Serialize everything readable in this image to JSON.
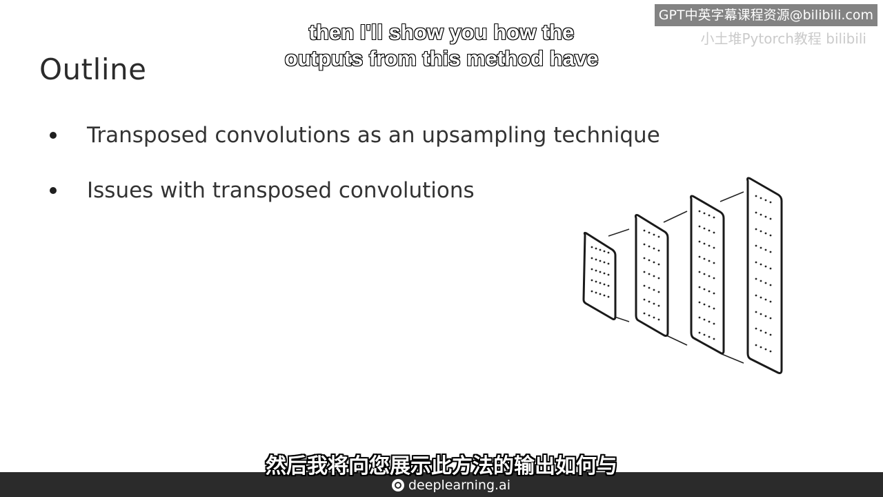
{
  "slide": {
    "title": "Outline",
    "bullets": [
      "Transposed convolutions as an upsampling technique",
      "Issues with transposed convolutions"
    ]
  },
  "subtitles": {
    "english_line1": "then I'll show you how the",
    "english_line2": "outputs from this method have",
    "chinese": "然后我将向您展示此方法的输出如何与"
  },
  "watermark": {
    "main": "GPT中英字幕课程资源@bilibili.com",
    "sub": "小土堆Pytorch教程 bilibili"
  },
  "footer": {
    "brand": "deeplearning.ai"
  },
  "diagram": {
    "description_icon": "upsampling-layers-icon",
    "layers": 4
  }
}
